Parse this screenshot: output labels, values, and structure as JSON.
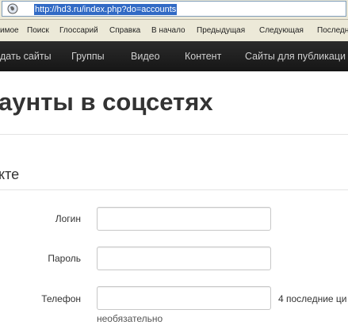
{
  "browser": {
    "url": "http://hd3.ru/index.php?do=accounts",
    "links": [
      "имое",
      "Поиск",
      "Глоссарий",
      "Справка",
      "В начало",
      "Предыдущая",
      "Следующая",
      "Последн"
    ]
  },
  "nav": {
    "items": [
      "дать сайты",
      "Группы",
      "Видео",
      "Контент",
      "Сайты для публикаци"
    ]
  },
  "page": {
    "title": "аунты в соцсетях",
    "section_title": "кте"
  },
  "form": {
    "login": {
      "label": "Логин",
      "value": ""
    },
    "password": {
      "label": "Пароль",
      "value": ""
    },
    "phone": {
      "label": "Телефон",
      "value": "",
      "help_inline": "4 последние ци",
      "help_block": "необязательно"
    }
  },
  "colors": {
    "nav_background": "#1c1c1c",
    "selection": "#316ac5",
    "chrome": "#ece9d8"
  }
}
